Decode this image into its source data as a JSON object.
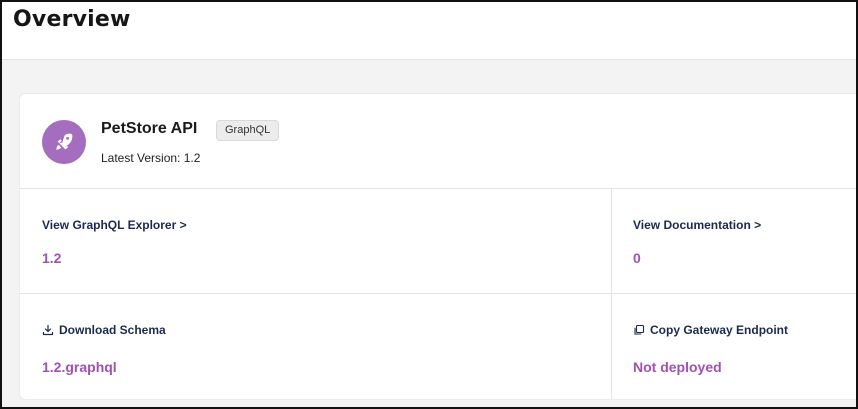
{
  "header": {
    "title": "Overview"
  },
  "api": {
    "name": "PetStore API",
    "type_badge": "GraphQL",
    "version_label": "Latest Version: 1.2",
    "avatar_icon": "rocket-icon",
    "avatar_color": "#a46dbd"
  },
  "tiles": {
    "explorer": {
      "link": "View GraphQL Explorer >",
      "value": "1.2"
    },
    "documentation": {
      "link": "View Documentation >",
      "value": "0"
    },
    "schema": {
      "link": "Download Schema",
      "value": "1.2.graphql",
      "icon": "download-icon"
    },
    "endpoint": {
      "link": "Copy Gateway Endpoint",
      "value": "Not deployed",
      "icon": "copy-icon"
    }
  },
  "colors": {
    "accent": "#a150b4",
    "link": "#1b2a4e"
  }
}
